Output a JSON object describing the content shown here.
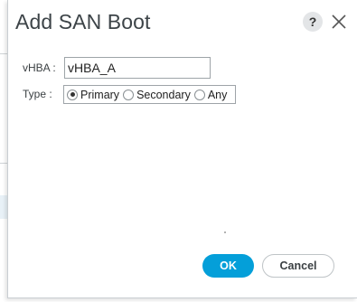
{
  "dialog": {
    "title": "Add SAN Boot",
    "help_label": "?",
    "close_icon": "close-icon"
  },
  "form": {
    "vhba_label": "vHBA :",
    "vhba_value": "vHBA_A",
    "type_label": "Type :",
    "type_options": [
      "Primary",
      "Secondary",
      "Any"
    ],
    "type_selected": "Primary"
  },
  "buttons": {
    "ok_label": "OK",
    "cancel_label": "Cancel"
  },
  "colors": {
    "accent": "#049fd9"
  }
}
